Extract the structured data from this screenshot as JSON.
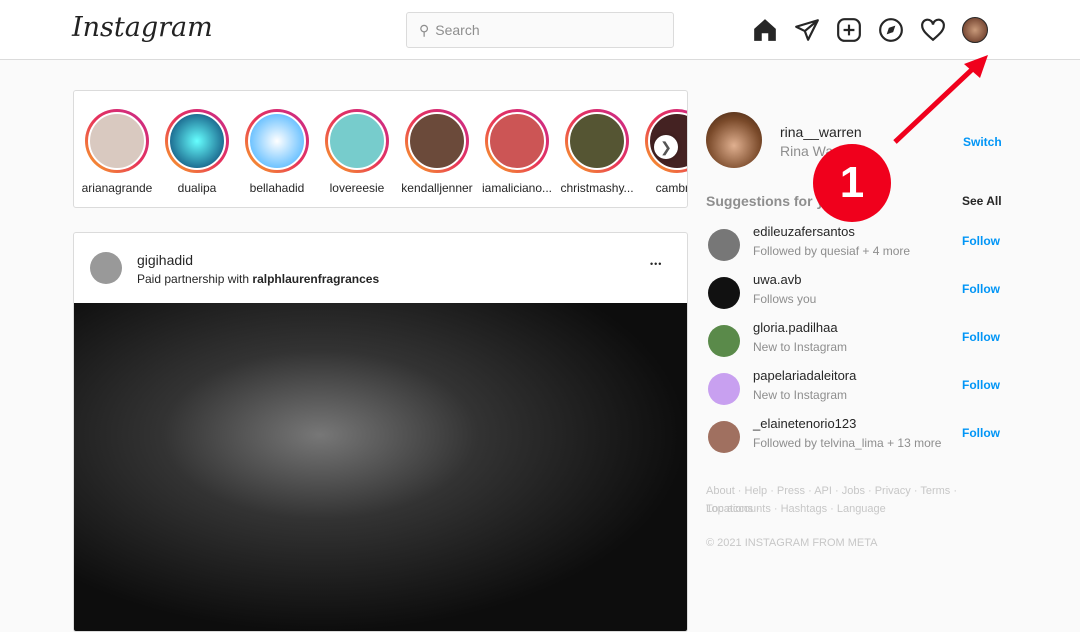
{
  "header": {
    "logo": "Instagram",
    "search_placeholder": "Search"
  },
  "stories": [
    "arianagrande",
    "dualipa",
    "bellahadid",
    "lovereesie",
    "kendalljenner",
    "iamaliciano...",
    "christmashy...",
    "cambria"
  ],
  "post": {
    "username": "gigihadid",
    "subtitle_prefix": "Paid partnership with ",
    "partner": "ralphlaurenfragrances",
    "more": "•••"
  },
  "profile": {
    "username": "rina__warren",
    "name": "Rina Warren",
    "switch": "Switch"
  },
  "suggestions": {
    "title": "Suggestions for you",
    "see_all": "See All",
    "items": [
      {
        "username": "edileuzafersantos",
        "sub": "Followed by quesiaf + 4 more",
        "follow": "Follow"
      },
      {
        "username": "uwa.avb",
        "sub": "Follows you",
        "follow": "Follow"
      },
      {
        "username": "gloria.padilhaa",
        "sub": "New to Instagram",
        "follow": "Follow"
      },
      {
        "username": "papelariadaleitora",
        "sub": "New to Instagram",
        "follow": "Follow"
      },
      {
        "username": "_elainetenorio123",
        "sub": "Followed by telvina_lima + 13 more",
        "follow": "Follow"
      }
    ]
  },
  "footer": {
    "links1": "About · Help · Press · API · Jobs · Privacy · Terms · Locations ·",
    "links2": "Top accounts · Hashtags · Language",
    "copyright": "© 2021 INSTAGRAM FROM META"
  },
  "annotation": {
    "badge": "1",
    "color": "#f0001c"
  }
}
